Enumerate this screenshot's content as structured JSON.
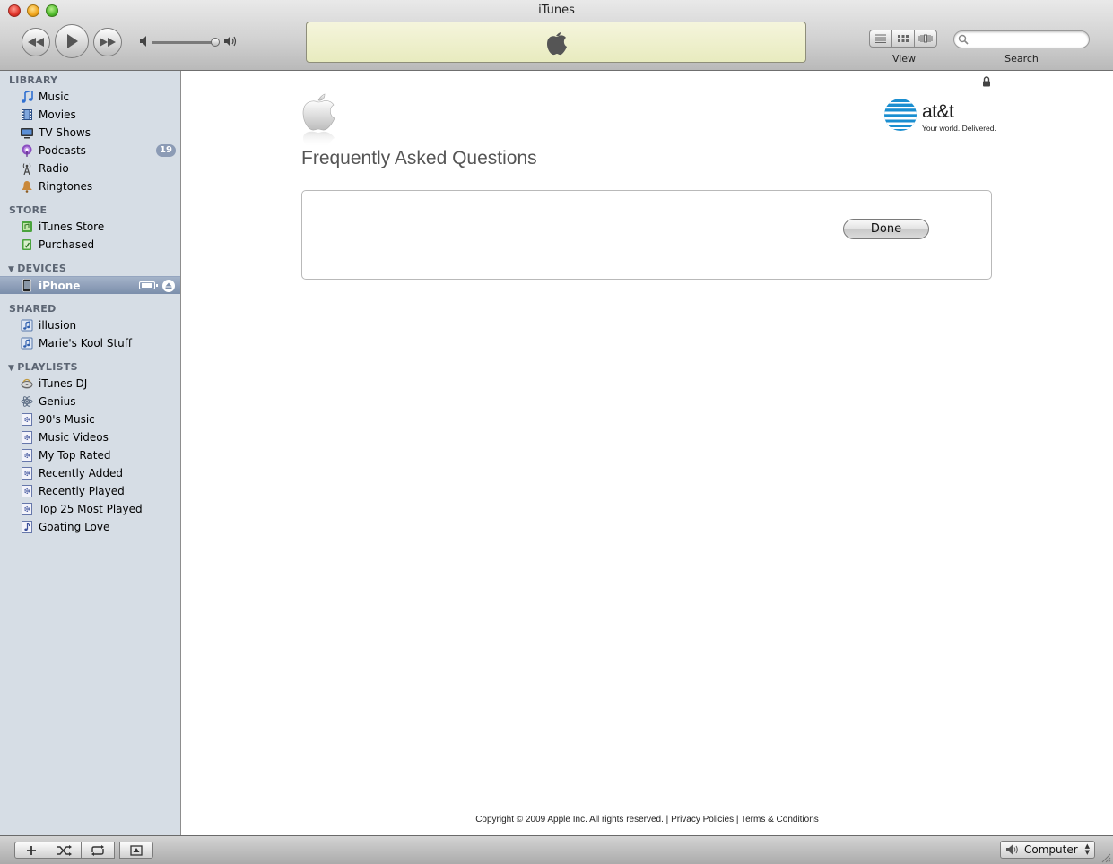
{
  "window": {
    "title": "iTunes"
  },
  "toolbar": {
    "view_label": "View",
    "search_label": "Search",
    "search_value": "",
    "search_placeholder": ""
  },
  "sidebar": {
    "sections": {
      "library": "LIBRARY",
      "store": "STORE",
      "devices": "DEVICES",
      "shared": "SHARED",
      "playlists": "PLAYLISTS"
    },
    "library": [
      {
        "label": "Music",
        "icon": "music-note-icon"
      },
      {
        "label": "Movies",
        "icon": "film-icon"
      },
      {
        "label": "TV Shows",
        "icon": "tv-icon"
      },
      {
        "label": "Podcasts",
        "icon": "podcast-icon",
        "badge": "19"
      },
      {
        "label": "Radio",
        "icon": "radio-antenna-icon"
      },
      {
        "label": "Ringtones",
        "icon": "bell-icon"
      }
    ],
    "store": [
      {
        "label": "iTunes Store",
        "icon": "store-icon"
      },
      {
        "label": "Purchased",
        "icon": "purchased-icon"
      }
    ],
    "devices": [
      {
        "label": "iPhone",
        "icon": "iphone-icon",
        "selected": true
      }
    ],
    "shared": [
      {
        "label": "illusion",
        "icon": "shared-library-icon"
      },
      {
        "label": "Marie's Kool Stuff",
        "icon": "shared-library-icon"
      }
    ],
    "playlists": [
      {
        "label": "iTunes DJ",
        "icon": "dj-icon"
      },
      {
        "label": "Genius",
        "icon": "genius-icon"
      },
      {
        "label": "90's Music",
        "icon": "smart-playlist-icon"
      },
      {
        "label": "Music Videos",
        "icon": "smart-playlist-icon"
      },
      {
        "label": "My Top Rated",
        "icon": "smart-playlist-icon"
      },
      {
        "label": "Recently Added",
        "icon": "smart-playlist-icon"
      },
      {
        "label": "Recently Played",
        "icon": "smart-playlist-icon"
      },
      {
        "label": "Top 25 Most Played",
        "icon": "smart-playlist-icon"
      },
      {
        "label": "Goating Love",
        "icon": "playlist-icon"
      }
    ]
  },
  "main": {
    "title": "Frequently Asked Questions",
    "done_label": "Done",
    "brand_text": "at&t",
    "brand_tagline": "Your world. Delivered.",
    "footer": {
      "copyright": "Copyright © 2009 Apple Inc. All rights reserved.",
      "separator": "|",
      "privacy": "Privacy Policies",
      "terms": "Terms & Conditions"
    }
  },
  "bottom": {
    "speakers_label": "Computer"
  },
  "colors": {
    "sidebar_bg": "#d6dde5",
    "selected_bg": "#7b8eab",
    "lcd_bg": "#f5f5dc",
    "badge_bg": "#8c9bb5"
  }
}
